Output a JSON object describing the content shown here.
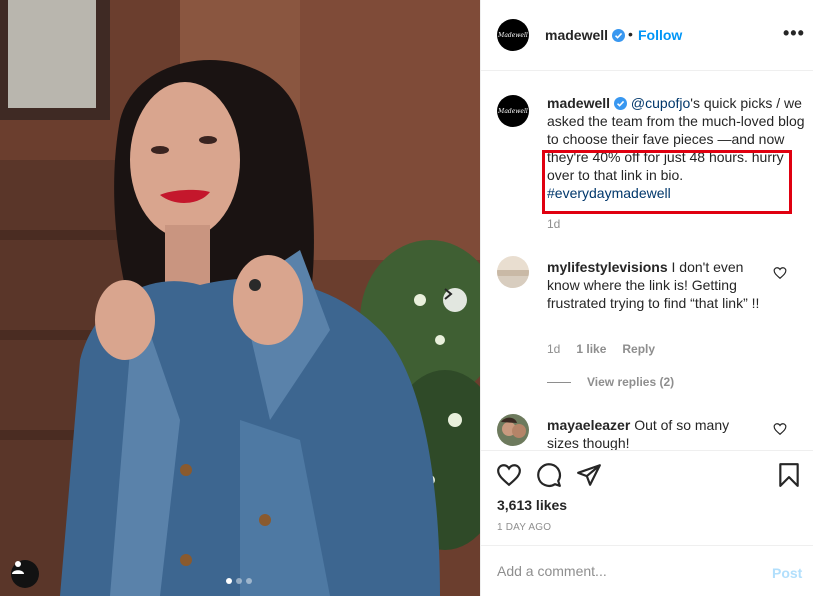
{
  "post": {
    "username": "madewell",
    "avatar_text": "Madewell",
    "verified": true,
    "separator": "•",
    "follow_label": "Follow",
    "more_label": "•••"
  },
  "caption": {
    "username": "madewell",
    "mention": "@cupofjo",
    "text_before_highlight": "'s quick picks / we asked the team from the much-loved blog to choose their fave pieces",
    "text_highlight": "—and now they're 40% off for just 48 hours. hurry over to that link in bio.",
    "hashtag": "#everydaymadewell",
    "time": "1d"
  },
  "comments": [
    {
      "username": "mylifestylevisions",
      "text": "I don't even know where the link is! Getting frustrated trying to find “that link” !!",
      "time": "1d",
      "likes": "1 like",
      "reply_label": "Reply",
      "view_replies": "View replies (2)"
    },
    {
      "username": "mayaeleazer",
      "text": "Out of so many sizes though!"
    }
  ],
  "actions": {
    "like_icon": "heart-icon",
    "comment_icon": "comment-icon",
    "share_icon": "share-icon",
    "save_icon": "bookmark-icon",
    "likes_count": "3,613 likes",
    "post_time": "1 DAY AGO"
  },
  "add_comment": {
    "placeholder": "Add a comment...",
    "post_label": "Post"
  },
  "colors": {
    "link_blue": "#0095f6",
    "verified_blue": "#3897f0",
    "highlight_red": "#e00010",
    "muted": "#8e8e8e"
  }
}
